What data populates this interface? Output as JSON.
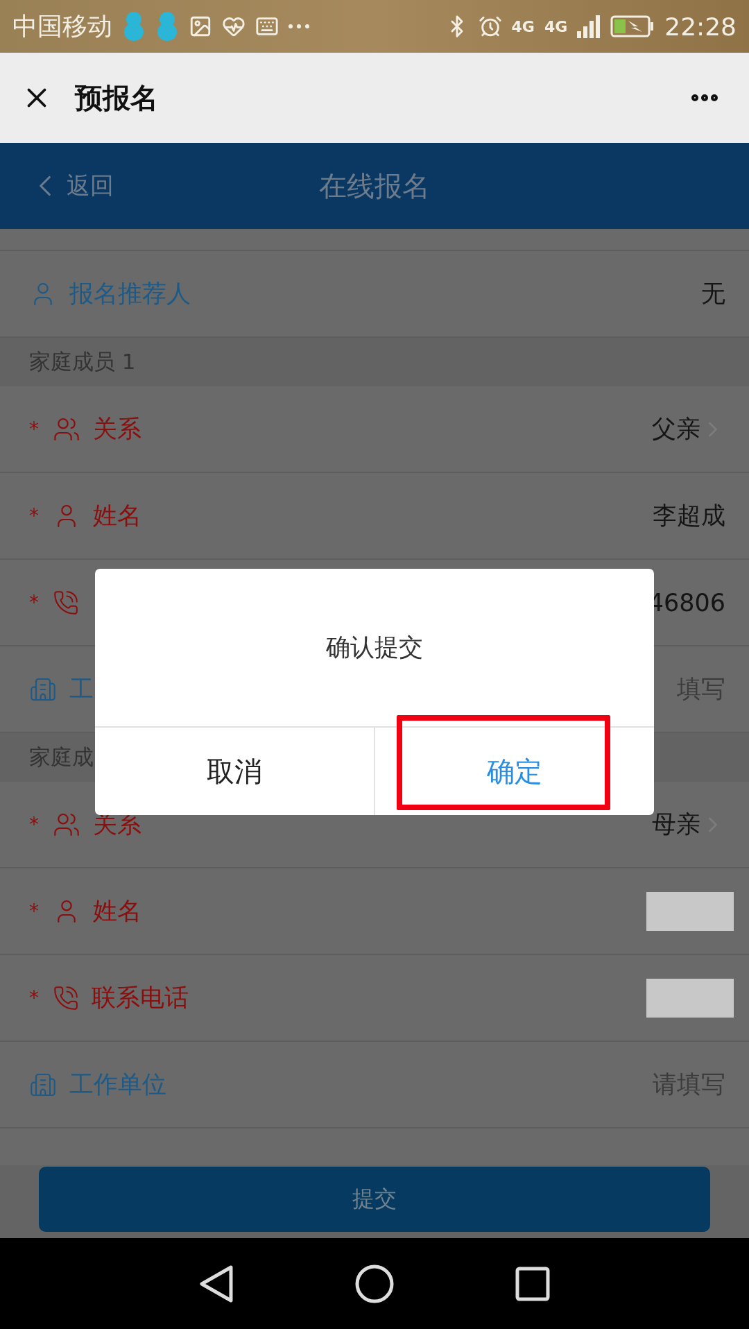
{
  "status_bar": {
    "carrier": "中国移动",
    "network_labels": [
      "4G",
      "4G"
    ],
    "time": "22:28"
  },
  "wechat_bar": {
    "title": "预报名"
  },
  "header": {
    "back": "返回",
    "title": "在线报名"
  },
  "referrer": {
    "kind": "person",
    "label": "报名推荐人",
    "value": "无"
  },
  "sections": [
    {
      "title": "家庭成员 1",
      "rows": [
        {
          "kind": "relation",
          "required_mark": "*",
          "label": "关系",
          "value": "父亲",
          "chevron": true
        },
        {
          "kind": "person",
          "required_mark": "*",
          "label": "姓名",
          "value": "李超成",
          "chevron": false
        },
        {
          "kind": "phone",
          "required_mark": "*",
          "value": "46806",
          "chevron": false
        },
        {
          "kind": "workplace",
          "label": "工",
          "placeholder": "填写",
          "chevron": false
        }
      ]
    },
    {
      "title": "家庭成",
      "rows": [
        {
          "kind": "relation",
          "required_mark": "*",
          "label": "关系",
          "value": "母亲",
          "chevron": true
        },
        {
          "kind": "person",
          "required_mark": "*",
          "label": "姓名",
          "redacted": true,
          "chevron": false
        },
        {
          "kind": "phone",
          "required_mark": "*",
          "label": "联系电话",
          "redacted": true,
          "chevron": false
        },
        {
          "kind": "workplace",
          "label": "工作单位",
          "placeholder": "请填写",
          "chevron": false
        }
      ]
    }
  ],
  "submit": "提交",
  "dialog": {
    "message": "确认提交",
    "buttons": [
      {
        "kind": "cancel",
        "label": "取消",
        "highlighted": false
      },
      {
        "kind": "confirm",
        "label": "确定",
        "highlighted": true
      }
    ]
  }
}
